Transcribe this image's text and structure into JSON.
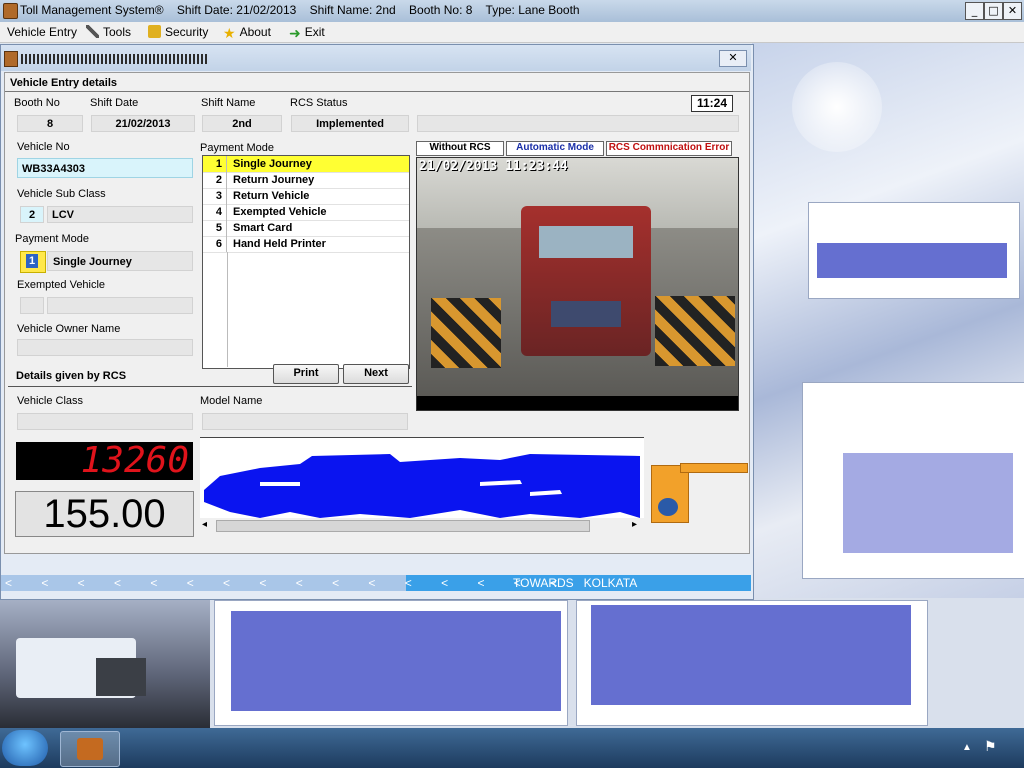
{
  "window": {
    "title": "Toll Management System®    Shift Date: 21/02/2013    Shift Name: 2nd    Booth No: 8    Type: Lane Booth",
    "min": "_",
    "max": "□",
    "close": "✕"
  },
  "menu": [
    {
      "label": "Vehicle Entry",
      "icon": ""
    },
    {
      "label": "Tools",
      "icon": "tools-icon"
    },
    {
      "label": "Security",
      "icon": "lock-icon"
    },
    {
      "label": "About",
      "icon": "star-icon"
    },
    {
      "label": "Exit",
      "icon": "exit-arrow-icon"
    }
  ],
  "form": {
    "section_title": "Vehicle Entry details",
    "clock": "11:24",
    "booth_no": {
      "label": "Booth No",
      "value": "8"
    },
    "shift_date": {
      "label": "Shift Date",
      "value": "21/02/2013"
    },
    "shift_name": {
      "label": "Shift Name",
      "value": "2nd"
    },
    "rcs_status": {
      "label": "RCS Status",
      "value": "Implemented"
    },
    "vehicle_no": {
      "label": "Vehicle No",
      "value": "WB33A4303"
    },
    "vehicle_sub_class": {
      "label": "Vehicle Sub Class",
      "code": "2",
      "value": "LCV"
    },
    "payment_mode": {
      "label": "Payment Mode",
      "code": "1",
      "value": "Single Journey"
    },
    "exempted_vehicle": {
      "label": "Exempted Vehicle",
      "code": "",
      "value": ""
    },
    "vehicle_owner_name": {
      "label": "Vehicle Owner Name",
      "value": ""
    },
    "rcs_details_title": "Details given by RCS",
    "vehicle_class": {
      "label": "Vehicle Class",
      "value": ""
    },
    "model_name": {
      "label": "Model Name",
      "value": ""
    }
  },
  "payment_list": {
    "label": "Payment Mode",
    "items": [
      {
        "num": "1",
        "label": "Single Journey",
        "selected": true
      },
      {
        "num": "2",
        "label": "Return Journey"
      },
      {
        "num": "3",
        "label": "Return Vehicle"
      },
      {
        "num": "4",
        "label": "Exempted Vehicle"
      },
      {
        "num": "5",
        "label": "Smart Card"
      },
      {
        "num": "6",
        "label": "Hand Held Printer"
      }
    ]
  },
  "buttons": {
    "print": "Print",
    "next": "Next"
  },
  "indicators": {
    "without_rcs": "Without RCS",
    "automatic_mode": "Automatic Mode",
    "rcs_error": "RCS Commnication Error"
  },
  "camera": {
    "timestamp": "21/02/2013 11:23:44"
  },
  "display": {
    "counter": "13260",
    "amount": "155.00"
  },
  "status_bar": {
    "arrows": "< < < < < < < < < < < < < < < <",
    "direction": "TOWARDS   KOLKATA"
  },
  "colors": {
    "selected_row": "#ffff33",
    "vehicle_no_bg": "#d9f4fb",
    "led_red": "#e0131b",
    "status_blue": "#3aa0e8",
    "profile_blue": "#0a14f0"
  }
}
